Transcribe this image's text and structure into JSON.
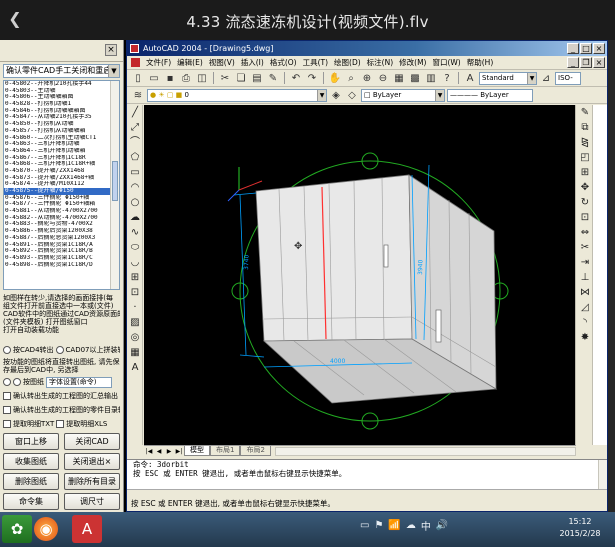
{
  "player": {
    "title": "4.33 流态速冻机设计(视频文件).flv",
    "back_glyph": "❮"
  },
  "left_panel": {
    "combo": "确认零件CAD手工关闭和重启",
    "list_items": [
      "0-45802--升降机210孔接手44",
      "0-45803--主动轴",
      "0-45806--主动轴轴箱图",
      "0-45828--打捞机动轴1",
      "0-45846--打捞机动轴轴箱图",
      "0-45847--从动轴210孔接手35",
      "0-45850--打捞机从动轴",
      "0-45857--打捞机从动轴轴箱",
      "0-45860--二次打捞机主动轴CT1",
      "0-45863--三机升降机动轴",
      "0-45864--三机升降机动轴箱",
      "0-45867--三机升降机1C18R",
      "0-45868--三机升降机1C18R+轴",
      "0-45870--提升轴/ZXX1468",
      "0-45873--提升轴/ZXX1468+轴",
      "0-45874--提升轴/M10X112",
      "0-45875--提升轴/Φ150",
      "0-45876--三件摘轮 Φ150+轴",
      "0-45877--三件摘轮 Φ150+轴箱",
      "0-45881--从动摘轮-4700X2700",
      "0-45882--从动摘轮-4700X2700",
      "0-45883--摘轮与货物-4700X2",
      "0-45886--摘轮后货架1200X38",
      "0-45887--后摘轮总货架1200X3",
      "0-45891--后摘轮货架1C18R/A",
      "0-45892--后摘轮货架1C18R/B",
      "0-45893--后摘轮货架1C18R/C",
      "0-45898--后摘轮货架1C18R/D"
    ],
    "selected_index": 16,
    "desc_lines": [
      "如图样在转少,请选择的画面接排(每",
      "组文件打开前直接选中一本或(文件)",
      "CAD软件中的图纸通过CAD资源原面的",
      "(文件夹模板) 打开图纸窗口",
      "打开自动装载功能"
    ],
    "opt_row1": {
      "a": "按CAD4转出",
      "b": "CAD07以上拼装输出"
    },
    "opt_row2_line1": "按功能的图纸将直接转出图纸, 请先保",
    "opt_row2_line2": "存最后到CAD中, 另选择",
    "opt_row3": {
      "label": "按图纸",
      "select": "字体设置(命令)"
    },
    "opt_row4_line1": "确认转出生成的工程图的汇总输出",
    "opt_row4_line2": "确认转出生成的工程图的零件目录输出",
    "opt_row5": {
      "a": "提取明细TXT",
      "b": "提取明细XLS"
    },
    "buttons": [
      [
        "",
        "窗口上移",
        "关闭CAD"
      ],
      [
        "",
        "收集图纸",
        "关闭退出×"
      ],
      [
        "",
        "删除图纸",
        "删除所有目录"
      ],
      [
        "",
        "命令集",
        "调尺寸"
      ]
    ]
  },
  "acad": {
    "title": "AutoCAD 2004 - [Drawing5.dwg]",
    "menu": [
      "文件(F)",
      "编辑(E)",
      "视图(V)",
      "插入(I)",
      "格式(O)",
      "工具(T)",
      "绘图(D)",
      "标注(N)",
      "修改(M)",
      "窗口(W)",
      "帮助(H)"
    ],
    "style_combo": "Standard",
    "style_combo2": "ISO-",
    "layer_combo": "0",
    "color_combo": "ByLayer",
    "linetype_combo": "ByLayer",
    "dims": {
      "width": "4000",
      "height_left": "3740",
      "height_right": "3940"
    },
    "tabs": [
      "模型",
      "布局1",
      "布局2"
    ],
    "cmd_lines": [
      "命令:  3dorbit",
      "按 ESC 或 ENTER 键退出, 或者单击鼠标右键显示快捷菜单。",
      ""
    ],
    "status": "按 ESC 或 ENTER 键退出, 或者单击鼠标右键显示快捷菜单。",
    "colors": {
      "orbit": "#22aa22",
      "cube": "#e8e8e8",
      "dim": "#00a0ff",
      "highlight": "#ff3030"
    }
  },
  "taskbar": {
    "time": "15:12",
    "date": "2015/2/28",
    "tray_glyphs": [
      "▭",
      "⚑",
      "📶",
      "☁",
      "中",
      "🔊"
    ]
  }
}
